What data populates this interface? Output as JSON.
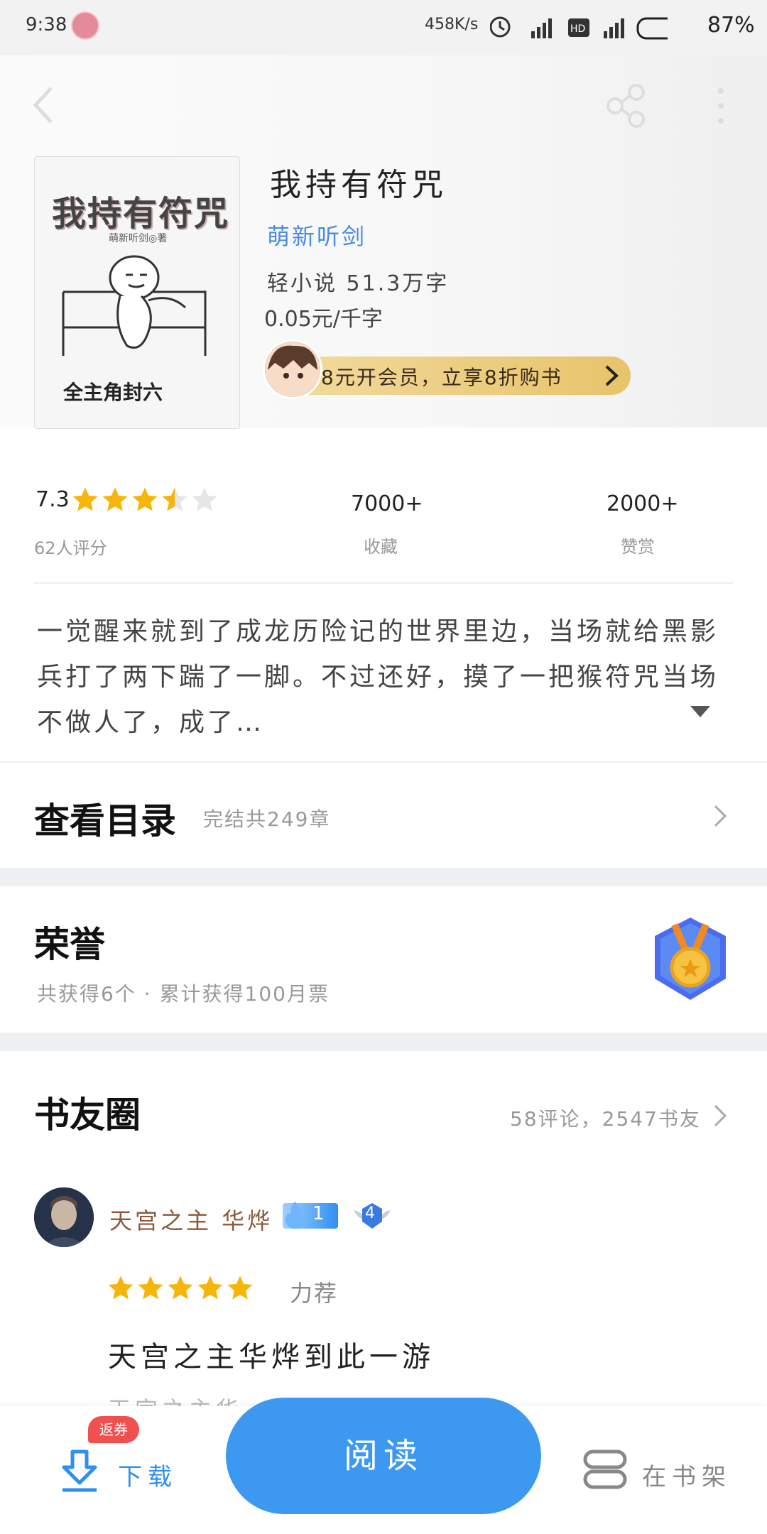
{
  "status_bar": {
    "time": "9:38",
    "net_speed": "458K/s",
    "battery": "87%"
  },
  "book": {
    "title": "我持有符咒",
    "author": "萌新听剑",
    "category_words": "轻小说  51.3万字",
    "price": "0.05元/千字",
    "cover": {
      "title": "我持有符咒",
      "author_line": "萌新听剑◎著",
      "footer": "全主角封六"
    }
  },
  "vip": {
    "text": "8元开会员，立享8折购书"
  },
  "stats": {
    "rating": "7.3",
    "stars_value": 3.5,
    "stars_max": 5,
    "rating_count": "62人评分",
    "favorites": "7000+",
    "favorites_label": "收藏",
    "rewards": "2000+",
    "rewards_label": "赞赏"
  },
  "description": "一觉醒来就到了成龙历险记的世界里边，当场就给黑影兵打了两下踹了一脚。不过还好，摸了一把猴符咒当场不做人了，成了…",
  "toc": {
    "title": "查看目录",
    "sub": "完结共249章"
  },
  "honor": {
    "title": "荣誉",
    "sub": "共获得6个 · 累计获得100月票"
  },
  "circle": {
    "title": "书友圈",
    "meta": "58评论，2547书友",
    "post": {
      "user": "天宫之主 华烨",
      "level": "1",
      "badge": "4",
      "stars": 5,
      "tag": "力荐",
      "title": "天宫之主华烨到此一游",
      "preview": "天宫之主华"
    }
  },
  "bottom_bar": {
    "coupon": "返券",
    "download": "下载",
    "read": "阅读",
    "shelf": "在书架"
  },
  "colors": {
    "accent": "#3c98f0",
    "author_link": "#4a8cde",
    "star": "#f5b50a",
    "vip_gold": "#e8c36a",
    "coupon_red": "#f05050"
  }
}
